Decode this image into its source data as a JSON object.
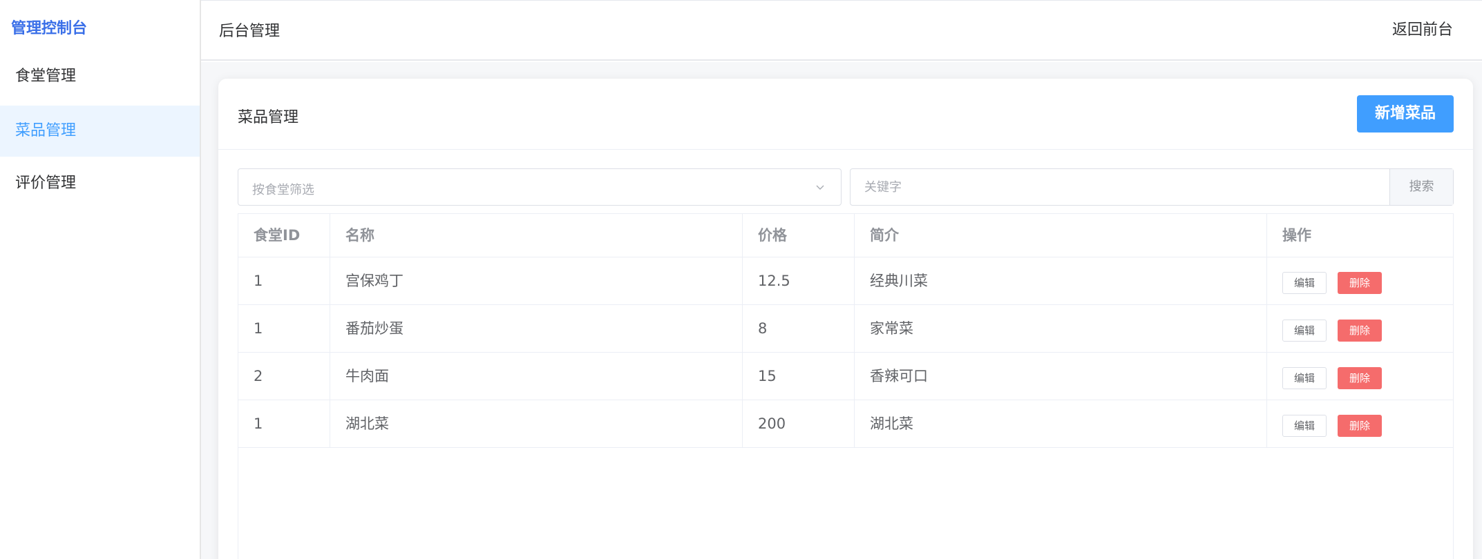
{
  "sidebar": {
    "brand": "管理控制台",
    "items": [
      {
        "label": "食堂管理"
      },
      {
        "label": "菜品管理"
      },
      {
        "label": "评价管理"
      }
    ]
  },
  "header": {
    "title": "后台管理",
    "back_label": "返回前台"
  },
  "card": {
    "title": "菜品管理",
    "add_button": "新增菜品"
  },
  "filters": {
    "canteen_placeholder": "按食堂筛选",
    "keyword_placeholder": "关键字",
    "search_button": "搜索"
  },
  "table": {
    "columns": [
      "食堂ID",
      "名称",
      "价格",
      "简介",
      "操作"
    ],
    "rows": [
      {
        "canteen_id": "1",
        "name": "宫保鸡丁",
        "price": "12.5",
        "intro": "经典川菜"
      },
      {
        "canteen_id": "1",
        "name": "番茄炒蛋",
        "price": "8",
        "intro": "家常菜"
      },
      {
        "canteen_id": "2",
        "name": "牛肉面",
        "price": "15",
        "intro": "香辣可口"
      },
      {
        "canteen_id": "1",
        "name": "湖北菜",
        "price": "200",
        "intro": "湖北菜"
      }
    ],
    "edit_label": "编辑",
    "delete_label": "删除"
  },
  "colors": {
    "primary": "#409eff",
    "danger": "#f56c6c",
    "brand": "#3a6fe8",
    "active_bg": "#ecf5ff"
  },
  "icons": {
    "select_arrow": "chevron-down-icon"
  }
}
